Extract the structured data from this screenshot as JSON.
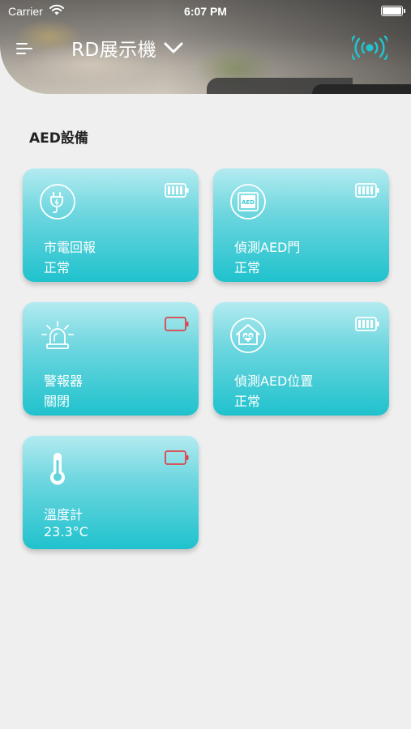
{
  "status_bar": {
    "carrier": "Carrier",
    "time": "6:07 PM"
  },
  "header": {
    "title": "RD展示機"
  },
  "section": {
    "title": "AED設備"
  },
  "devices": [
    {
      "name": "市電回報",
      "state": "正常",
      "icon": "power-plug-icon",
      "battery": "full"
    },
    {
      "name": "偵測AED門",
      "state": "正常",
      "icon": "aed-box-icon",
      "battery": "full"
    },
    {
      "name": "警報器",
      "state": "關閉",
      "icon": "siren-icon",
      "battery": "low"
    },
    {
      "name": "偵測AED位置",
      "state": "正常",
      "icon": "aed-location-icon",
      "battery": "full"
    },
    {
      "name": "溫度計",
      "state": "23.3°C",
      "icon": "thermometer-icon",
      "battery": "low"
    }
  ],
  "colors": {
    "card_top": "#b3ebf0",
    "card_bottom": "#1fc2cd",
    "accent": "#1ab3c2",
    "battery_low": "#e0424a",
    "background": "#efefef"
  }
}
